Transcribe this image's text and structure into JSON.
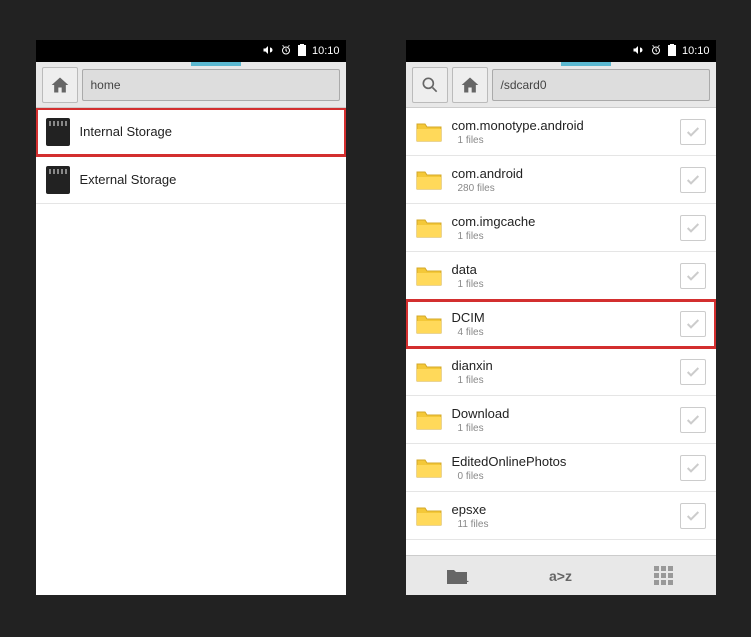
{
  "status": {
    "time": "10:10"
  },
  "left": {
    "path": "home",
    "items": [
      {
        "name": "Internal Storage",
        "highlighted": true
      },
      {
        "name": "External Storage",
        "highlighted": false
      }
    ]
  },
  "right": {
    "path": "/sdcard0",
    "items": [
      {
        "name": "com.monotype.android",
        "sub": "1 files",
        "highlighted": false
      },
      {
        "name": "com.android",
        "sub": "280 files",
        "highlighted": false
      },
      {
        "name": "com.imgcache",
        "sub": "1 files",
        "highlighted": false
      },
      {
        "name": "data",
        "sub": "1 files",
        "highlighted": false
      },
      {
        "name": "DCIM",
        "sub": "4 files",
        "highlighted": true
      },
      {
        "name": "dianxin",
        "sub": "1 files",
        "highlighted": false
      },
      {
        "name": "Download",
        "sub": "1 files",
        "highlighted": false
      },
      {
        "name": "EditedOnlinePhotos",
        "sub": "0 files",
        "highlighted": false
      },
      {
        "name": "epsxe",
        "sub": "11 files",
        "highlighted": false
      }
    ]
  },
  "bottombar": {
    "sort_label": "a>z"
  }
}
